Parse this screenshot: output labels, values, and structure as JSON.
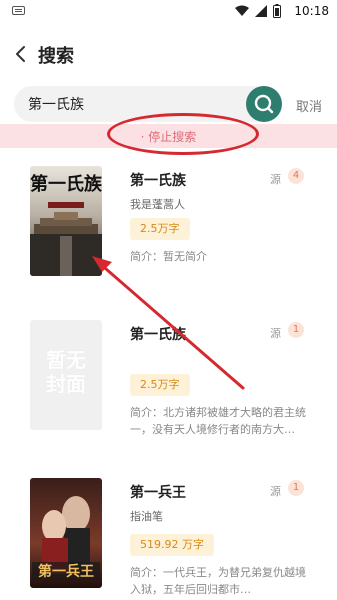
{
  "status_bar": {
    "time": "10:18"
  },
  "header": {
    "title": "搜索"
  },
  "search": {
    "query": "第一氏族",
    "cancel_label": "取消"
  },
  "stop_search": {
    "label": "· 停止搜索"
  },
  "results": [
    {
      "title": "第一氏族",
      "author": "我是蓬蒿人",
      "words": "2.5万字",
      "intro": "简介：暂无简介",
      "source_label": "源",
      "source_count": "4",
      "cover": "ancient-city"
    },
    {
      "title": "第一氏族",
      "author": "",
      "words": "2.5万字",
      "intro": "简介：北方诸邦被雄才大略的君主统一，没有天人境修行者的南方大…",
      "source_label": "源",
      "source_count": "1",
      "cover": "placeholder",
      "cover_text": "暂无封面"
    },
    {
      "title": "第一兵王",
      "author": "指油笔",
      "words": "519.92 万字",
      "intro": "简介：一代兵王，为替兄弟复仇越境入狱，五年后回归都市…",
      "source_label": "源",
      "source_count": "1",
      "cover": "couple"
    }
  ],
  "colors": {
    "accent": "#2e7d6e",
    "stop_bg": "#fbe1e4",
    "stop_text": "#e06b7a",
    "annotation": "#d5282f",
    "badge_bg": "#fdf1d8",
    "badge_text": "#d68a18"
  }
}
